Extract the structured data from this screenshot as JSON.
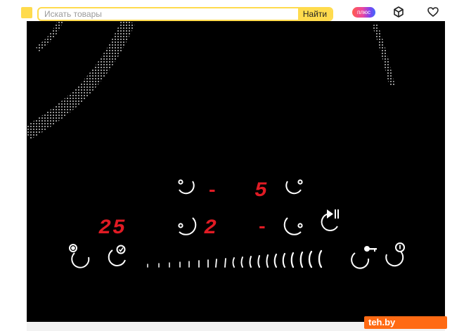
{
  "header": {
    "search": {
      "placeholder": "Искать товары",
      "button_label": "Найти"
    },
    "plus_badge": "плюс",
    "icons": [
      "cube-icon",
      "heart-icon"
    ]
  },
  "cooktop": {
    "displays": {
      "timer": "25",
      "zone_top_left": "-",
      "zone_top_right": "5",
      "zone_bottom_left": "2",
      "zone_bottom_right": "-"
    },
    "led_color": "#e01b24",
    "control_color": "#ffffff",
    "controls": [
      "zone-top-left-icon",
      "zone-top-right-icon",
      "zone-bottom-left-icon",
      "zone-bottom-right-icon",
      "pause-play-icon",
      "timer-icon",
      "confirm-icon",
      "slider-scale",
      "key-lock-icon",
      "power-icon"
    ]
  },
  "watermark": {
    "text": "teh.by"
  }
}
